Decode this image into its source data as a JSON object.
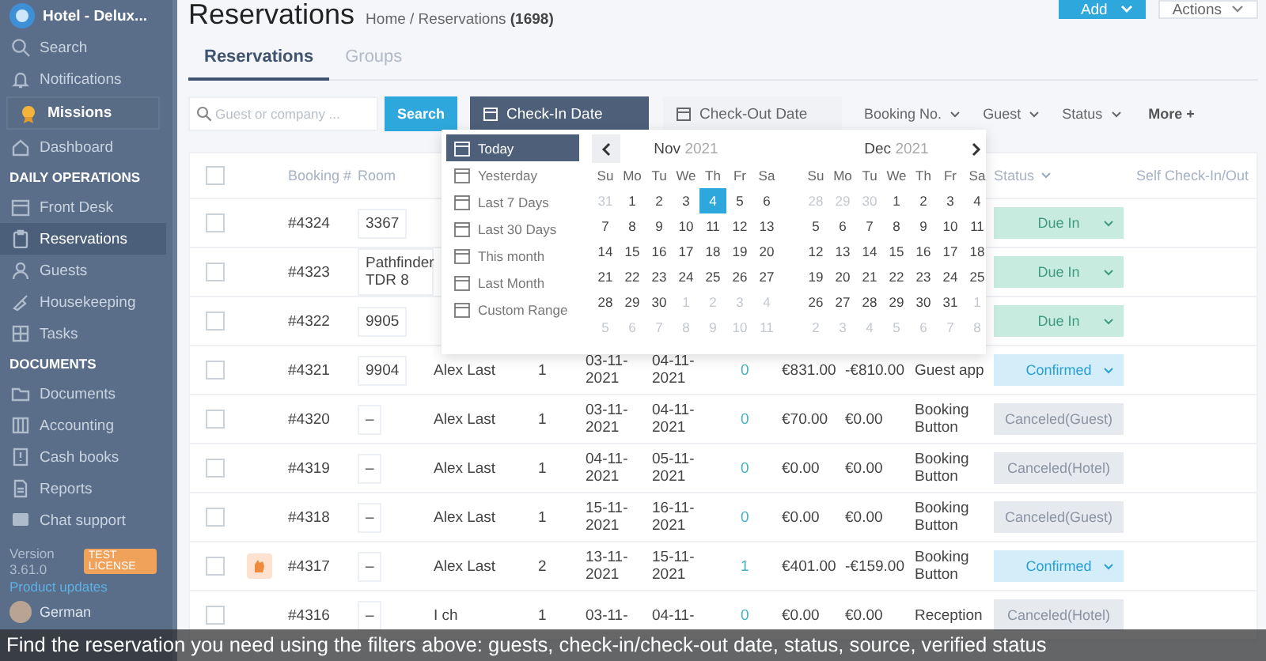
{
  "sidebar": {
    "hotel": "Hotel - Delux...",
    "items": [
      {
        "kind": "item",
        "label": "Search",
        "selected": false
      },
      {
        "kind": "item",
        "label": "Notifications",
        "selected": false
      },
      {
        "kind": "mission",
        "label": "Missions",
        "selected": false
      },
      {
        "kind": "item",
        "label": "Dashboard",
        "selected": false
      },
      {
        "kind": "section",
        "label": "DAILY OPERATIONS"
      },
      {
        "kind": "item",
        "label": "Front Desk",
        "selected": false
      },
      {
        "kind": "item",
        "label": "Reservations",
        "selected": true
      },
      {
        "kind": "item",
        "label": "Guests",
        "selected": false
      },
      {
        "kind": "item",
        "label": "Housekeeping",
        "selected": false
      },
      {
        "kind": "item",
        "label": "Tasks",
        "selected": false
      },
      {
        "kind": "section",
        "label": "DOCUMENTS"
      },
      {
        "kind": "item",
        "label": "Documents",
        "selected": false
      },
      {
        "kind": "item",
        "label": "Accounting",
        "selected": false
      },
      {
        "kind": "item",
        "label": "Cash books",
        "selected": false
      },
      {
        "kind": "item",
        "label": "Reports",
        "selected": false
      },
      {
        "kind": "item",
        "label": "Chat support",
        "selected": false
      }
    ],
    "version": "Version 3.61.0",
    "license": "TEST LICENSE",
    "updates": "Product updates",
    "user": "German"
  },
  "header": {
    "title": "Reservations",
    "breadcrumb": "Home / Reservations **(1698)**",
    "add": "Add",
    "actions": "Actions"
  },
  "tabs": [
    {
      "label": "Reservations",
      "selected": true
    },
    {
      "label": "Groups",
      "selected": false
    }
  ],
  "filters": {
    "search_placeholder": "Guest or company ...",
    "search_button": "Search",
    "dates": [
      {
        "label": "Check-In Date",
        "selected": true
      },
      {
        "label": "Check-Out Date",
        "selected": false
      }
    ],
    "dropdowns": [
      "Booking No.",
      "Guest",
      "Status"
    ],
    "more": "More +"
  },
  "table": {
    "columns": {
      "booking": "Booking #",
      "room": "Room",
      "status": "Status",
      "self": "Self Check-In/Out"
    },
    "select_all": false,
    "rows": [
      {
        "checked": false,
        "booking": "#4324",
        "room": "3367",
        "status": {
          "label": "Due In",
          "kind": "due_in"
        },
        "marked": false
      },
      {
        "checked": false,
        "booking": "#4323",
        "room": "Pathfinder TDR 8",
        "status": {
          "label": "Due In",
          "kind": "due_in"
        },
        "marked": false
      },
      {
        "checked": false,
        "booking": "#4322",
        "room": "9905",
        "status": {
          "label": "Due In",
          "kind": "due_in"
        },
        "marked": false
      },
      {
        "checked": false,
        "booking": "#4321",
        "room": "9904",
        "guest": "Alex Last",
        "column_6": "1",
        "check_in": "03-11-2021",
        "check_out": "04-11-2021",
        "column_9": "0",
        "price": "€831.00",
        "balance": "-€810.00",
        "source": "Guest app",
        "status": {
          "label": "Confirmed",
          "kind": "confirmed"
        },
        "marked": false
      },
      {
        "checked": false,
        "booking": "#4320",
        "room": "–",
        "guest": "Alex Last",
        "column_6": "1",
        "check_in": "03-11-2021",
        "check_out": "04-11-2021",
        "column_9": "0",
        "price": "€70.00",
        "balance": "€0.00",
        "source": "Booking Button",
        "status": {
          "label": "Canceled(Guest)",
          "kind": "canceled"
        },
        "marked": false
      },
      {
        "checked": false,
        "booking": "#4319",
        "room": "–",
        "guest": "Alex Last",
        "column_6": "1",
        "check_in": "04-11-2021",
        "check_out": "05-11-2021",
        "column_9": "0",
        "price": "€0.00",
        "balance": "€0.00",
        "source": "Booking Button",
        "status": {
          "label": "Canceled(Hotel)",
          "kind": "canceled"
        },
        "marked": false
      },
      {
        "checked": false,
        "booking": "#4318",
        "room": "–",
        "guest": "Alex Last",
        "column_6": "1",
        "check_in": "15-11-2021",
        "check_out": "16-11-2021",
        "column_9": "0",
        "price": "€0.00",
        "balance": "€0.00",
        "source": "Booking Button",
        "status": {
          "label": "Canceled(Guest)",
          "kind": "canceled"
        },
        "marked": false
      },
      {
        "checked": false,
        "booking": "#4317",
        "room": "–",
        "guest": "Alex Last",
        "column_6": "2",
        "check_in": "13-11-2021",
        "check_out": "15-11-2021",
        "column_9": "1",
        "price": "€401.00",
        "balance": "-€159.00",
        "source": "Booking Button",
        "status": {
          "label": "Confirmed",
          "kind": "confirmed"
        },
        "marked": true
      },
      {
        "checked": false,
        "booking": "#4316",
        "room": "–",
        "guest": "I ch",
        "column_6": "1",
        "check_in": "03-11-",
        "check_out": "04-11-",
        "column_9": "0",
        "price": "€0.00",
        "balance": "€0.00",
        "source": "Reception",
        "status": {
          "label": "Canceled(Hotel)",
          "kind": "canceled"
        },
        "marked": false
      }
    ]
  },
  "picker": {
    "ranges": [
      {
        "label": "Today",
        "selected": true
      },
      {
        "label": "Yesterday",
        "selected": false
      },
      {
        "label": "Last 7 Days",
        "selected": false
      },
      {
        "label": "Last 30 Days",
        "selected": false
      },
      {
        "label": "This month",
        "selected": false
      },
      {
        "label": "Last Month",
        "selected": false
      },
      {
        "label": "Custom Range",
        "selected": false
      }
    ],
    "months": [
      {
        "month": "Nov",
        "year": "2021",
        "weekdays": [
          "Su",
          "Mo",
          "Tu",
          "We",
          "Th",
          "Fr",
          "Sa"
        ],
        "days": [
          {
            "t": "31",
            "muted": true,
            "selected": false
          },
          {
            "t": "1",
            "muted": false,
            "selected": false
          },
          {
            "t": "2",
            "muted": false,
            "selected": false
          },
          {
            "t": "3",
            "muted": false,
            "selected": false
          },
          {
            "t": "4",
            "muted": false,
            "selected": true
          },
          {
            "t": "5",
            "muted": false,
            "selected": false
          },
          {
            "t": "6",
            "muted": false,
            "selected": false
          },
          {
            "t": "7",
            "muted": false,
            "selected": false
          },
          {
            "t": "8",
            "muted": false,
            "selected": false
          },
          {
            "t": "9",
            "muted": false,
            "selected": false
          },
          {
            "t": "10",
            "muted": false,
            "selected": false
          },
          {
            "t": "11",
            "muted": false,
            "selected": false
          },
          {
            "t": "12",
            "muted": false,
            "selected": false
          },
          {
            "t": "13",
            "muted": false,
            "selected": false
          },
          {
            "t": "14",
            "muted": false,
            "selected": false
          },
          {
            "t": "15",
            "muted": false,
            "selected": false
          },
          {
            "t": "16",
            "muted": false,
            "selected": false
          },
          {
            "t": "17",
            "muted": false,
            "selected": false
          },
          {
            "t": "18",
            "muted": false,
            "selected": false
          },
          {
            "t": "19",
            "muted": false,
            "selected": false
          },
          {
            "t": "20",
            "muted": false,
            "selected": false
          },
          {
            "t": "21",
            "muted": false,
            "selected": false
          },
          {
            "t": "22",
            "muted": false,
            "selected": false
          },
          {
            "t": "23",
            "muted": false,
            "selected": false
          },
          {
            "t": "24",
            "muted": false,
            "selected": false
          },
          {
            "t": "25",
            "muted": false,
            "selected": false
          },
          {
            "t": "26",
            "muted": false,
            "selected": false
          },
          {
            "t": "27",
            "muted": false,
            "selected": false
          },
          {
            "t": "28",
            "muted": false,
            "selected": false
          },
          {
            "t": "29",
            "muted": false,
            "selected": false
          },
          {
            "t": "30",
            "muted": false,
            "selected": false
          },
          {
            "t": "1",
            "muted": true,
            "selected": false
          },
          {
            "t": "2",
            "muted": true,
            "selected": false
          },
          {
            "t": "3",
            "muted": true,
            "selected": false
          },
          {
            "t": "4",
            "muted": true,
            "selected": false
          },
          {
            "t": "5",
            "muted": true,
            "selected": false
          },
          {
            "t": "6",
            "muted": true,
            "selected": false
          },
          {
            "t": "7",
            "muted": true,
            "selected": false
          },
          {
            "t": "8",
            "muted": true,
            "selected": false
          },
          {
            "t": "9",
            "muted": true,
            "selected": false
          },
          {
            "t": "10",
            "muted": true,
            "selected": false
          },
          {
            "t": "11",
            "muted": true,
            "selected": false
          }
        ]
      },
      {
        "month": "Dec",
        "year": "2021",
        "weekdays": [
          "Su",
          "Mo",
          "Tu",
          "We",
          "Th",
          "Fr",
          "Sa"
        ],
        "days": [
          {
            "t": "28",
            "muted": true,
            "selected": false
          },
          {
            "t": "29",
            "muted": true,
            "selected": false
          },
          {
            "t": "30",
            "muted": true,
            "selected": false
          },
          {
            "t": "1",
            "muted": false,
            "selected": false
          },
          {
            "t": "2",
            "muted": false,
            "selected": false
          },
          {
            "t": "3",
            "muted": false,
            "selected": false
          },
          {
            "t": "4",
            "muted": false,
            "selected": false
          },
          {
            "t": "5",
            "muted": false,
            "selected": false
          },
          {
            "t": "6",
            "muted": false,
            "selected": false
          },
          {
            "t": "7",
            "muted": false,
            "selected": false
          },
          {
            "t": "8",
            "muted": false,
            "selected": false
          },
          {
            "t": "9",
            "muted": false,
            "selected": false
          },
          {
            "t": "10",
            "muted": false,
            "selected": false
          },
          {
            "t": "11",
            "muted": false,
            "selected": false
          },
          {
            "t": "12",
            "muted": false,
            "selected": false
          },
          {
            "t": "13",
            "muted": false,
            "selected": false
          },
          {
            "t": "14",
            "muted": false,
            "selected": false
          },
          {
            "t": "15",
            "muted": false,
            "selected": false
          },
          {
            "t": "16",
            "muted": false,
            "selected": false
          },
          {
            "t": "17",
            "muted": false,
            "selected": false
          },
          {
            "t": "18",
            "muted": false,
            "selected": false
          },
          {
            "t": "19",
            "muted": false,
            "selected": false
          },
          {
            "t": "20",
            "muted": false,
            "selected": false
          },
          {
            "t": "21",
            "muted": false,
            "selected": false
          },
          {
            "t": "22",
            "muted": false,
            "selected": false
          },
          {
            "t": "23",
            "muted": false,
            "selected": false
          },
          {
            "t": "24",
            "muted": false,
            "selected": false
          },
          {
            "t": "25",
            "muted": false,
            "selected": false
          },
          {
            "t": "26",
            "muted": false,
            "selected": false
          },
          {
            "t": "27",
            "muted": false,
            "selected": false
          },
          {
            "t": "28",
            "muted": false,
            "selected": false
          },
          {
            "t": "29",
            "muted": false,
            "selected": false
          },
          {
            "t": "30",
            "muted": false,
            "selected": false
          },
          {
            "t": "31",
            "muted": false,
            "selected": false
          },
          {
            "t": "1",
            "muted": true,
            "selected": false
          },
          {
            "t": "2",
            "muted": true,
            "selected": false
          },
          {
            "t": "3",
            "muted": true,
            "selected": false
          },
          {
            "t": "4",
            "muted": true,
            "selected": false
          },
          {
            "t": "5",
            "muted": true,
            "selected": false
          },
          {
            "t": "6",
            "muted": true,
            "selected": false
          },
          {
            "t": "7",
            "muted": true,
            "selected": false
          },
          {
            "t": "8",
            "muted": true,
            "selected": false
          }
        ]
      }
    ]
  },
  "caption": "Find the reservation you need using the filters above: guests, check-in/check-out date, status, source, verified status"
}
